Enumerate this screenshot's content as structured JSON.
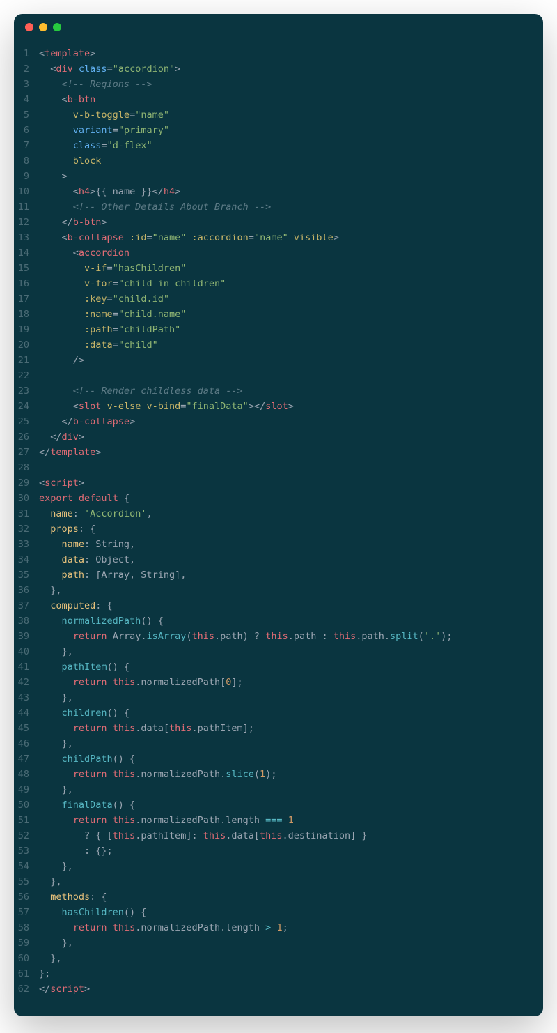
{
  "window": {
    "traffic_lights": [
      "close",
      "minimize",
      "zoom"
    ]
  },
  "code": {
    "lines": [
      {
        "n": 1,
        "t": [
          [
            "p",
            "<"
          ],
          [
            "t",
            "template"
          ],
          [
            "p",
            ">"
          ]
        ]
      },
      {
        "n": 2,
        "t": [
          [
            "p",
            "  <"
          ],
          [
            "t",
            "div"
          ],
          [
            "p",
            " "
          ],
          [
            "bl",
            "class"
          ],
          [
            "p",
            "="
          ],
          [
            "s",
            "\"accordion\""
          ],
          [
            "p",
            ">"
          ]
        ]
      },
      {
        "n": 3,
        "t": [
          [
            "c",
            "    <!-- Regions -->"
          ]
        ]
      },
      {
        "n": 4,
        "t": [
          [
            "p",
            "    <"
          ],
          [
            "t",
            "b-btn"
          ]
        ]
      },
      {
        "n": 5,
        "t": [
          [
            "p",
            "      "
          ],
          [
            "a",
            "v-b-toggle"
          ],
          [
            "p",
            "="
          ],
          [
            "s",
            "\"name\""
          ]
        ]
      },
      {
        "n": 6,
        "t": [
          [
            "p",
            "      "
          ],
          [
            "bl",
            "variant"
          ],
          [
            "p",
            "="
          ],
          [
            "s",
            "\"primary\""
          ]
        ]
      },
      {
        "n": 7,
        "t": [
          [
            "p",
            "      "
          ],
          [
            "bl",
            "class"
          ],
          [
            "p",
            "="
          ],
          [
            "s",
            "\"d-flex\""
          ]
        ]
      },
      {
        "n": 8,
        "t": [
          [
            "p",
            "      "
          ],
          [
            "a",
            "block"
          ]
        ]
      },
      {
        "n": 9,
        "t": [
          [
            "p",
            "    >"
          ]
        ]
      },
      {
        "n": 10,
        "t": [
          [
            "p",
            "      <"
          ],
          [
            "t",
            "h4"
          ],
          [
            "p",
            ">{{ name }}</"
          ],
          [
            "t",
            "h4"
          ],
          [
            "p",
            ">"
          ]
        ]
      },
      {
        "n": 11,
        "t": [
          [
            "c",
            "      <!-- Other Details About Branch -->"
          ]
        ]
      },
      {
        "n": 12,
        "t": [
          [
            "p",
            "    </"
          ],
          [
            "t",
            "b-btn"
          ],
          [
            "p",
            ">"
          ]
        ]
      },
      {
        "n": 13,
        "t": [
          [
            "p",
            "    <"
          ],
          [
            "t",
            "b-collapse"
          ],
          [
            "p",
            " "
          ],
          [
            "a",
            ":id"
          ],
          [
            "p",
            "="
          ],
          [
            "s",
            "\"name\""
          ],
          [
            "p",
            " "
          ],
          [
            "a",
            ":accordion"
          ],
          [
            "p",
            "="
          ],
          [
            "s",
            "\"name\""
          ],
          [
            "p",
            " "
          ],
          [
            "a",
            "visible"
          ],
          [
            "p",
            ">"
          ]
        ]
      },
      {
        "n": 14,
        "t": [
          [
            "p",
            "      <"
          ],
          [
            "t",
            "accordion"
          ]
        ]
      },
      {
        "n": 15,
        "t": [
          [
            "p",
            "        "
          ],
          [
            "a",
            "v-if"
          ],
          [
            "p",
            "="
          ],
          [
            "s",
            "\"hasChildren\""
          ]
        ]
      },
      {
        "n": 16,
        "t": [
          [
            "p",
            "        "
          ],
          [
            "a",
            "v-for"
          ],
          [
            "p",
            "="
          ],
          [
            "s",
            "\"child in children\""
          ]
        ]
      },
      {
        "n": 17,
        "t": [
          [
            "p",
            "        "
          ],
          [
            "a",
            ":key"
          ],
          [
            "p",
            "="
          ],
          [
            "s",
            "\"child.id\""
          ]
        ]
      },
      {
        "n": 18,
        "t": [
          [
            "p",
            "        "
          ],
          [
            "a",
            ":name"
          ],
          [
            "p",
            "="
          ],
          [
            "s",
            "\"child.name\""
          ]
        ]
      },
      {
        "n": 19,
        "t": [
          [
            "p",
            "        "
          ],
          [
            "a",
            ":path"
          ],
          [
            "p",
            "="
          ],
          [
            "s",
            "\"childPath\""
          ]
        ]
      },
      {
        "n": 20,
        "t": [
          [
            "p",
            "        "
          ],
          [
            "a",
            ":data"
          ],
          [
            "p",
            "="
          ],
          [
            "s",
            "\"child\""
          ]
        ]
      },
      {
        "n": 21,
        "t": [
          [
            "p",
            "      />"
          ]
        ]
      },
      {
        "n": 22,
        "t": [
          [
            "p",
            ""
          ]
        ]
      },
      {
        "n": 23,
        "t": [
          [
            "c",
            "      <!-- Render childless data -->"
          ]
        ]
      },
      {
        "n": 24,
        "t": [
          [
            "p",
            "      <"
          ],
          [
            "t",
            "slot"
          ],
          [
            "p",
            " "
          ],
          [
            "a",
            "v-else"
          ],
          [
            "p",
            " "
          ],
          [
            "a",
            "v-bind"
          ],
          [
            "p",
            "="
          ],
          [
            "s",
            "\"finalData\""
          ],
          [
            "p",
            "></"
          ],
          [
            "t",
            "slot"
          ],
          [
            "p",
            ">"
          ]
        ]
      },
      {
        "n": 25,
        "t": [
          [
            "p",
            "    </"
          ],
          [
            "t",
            "b-collapse"
          ],
          [
            "p",
            ">"
          ]
        ]
      },
      {
        "n": 26,
        "t": [
          [
            "p",
            "  </"
          ],
          [
            "t",
            "div"
          ],
          [
            "p",
            ">"
          ]
        ]
      },
      {
        "n": 27,
        "t": [
          [
            "p",
            "</"
          ],
          [
            "t",
            "template"
          ],
          [
            "p",
            ">"
          ]
        ]
      },
      {
        "n": 28,
        "t": [
          [
            "p",
            ""
          ]
        ]
      },
      {
        "n": 29,
        "t": [
          [
            "p",
            "<"
          ],
          [
            "t",
            "script"
          ],
          [
            "p",
            ">"
          ]
        ]
      },
      {
        "n": 30,
        "t": [
          [
            "k",
            "export"
          ],
          [
            "p",
            " "
          ],
          [
            "k",
            "default"
          ],
          [
            "p",
            " {"
          ]
        ]
      },
      {
        "n": 31,
        "t": [
          [
            "p",
            "  "
          ],
          [
            "pr",
            "name"
          ],
          [
            "p",
            ": "
          ],
          [
            "s",
            "'Accordion'"
          ],
          [
            "p",
            ","
          ]
        ]
      },
      {
        "n": 32,
        "t": [
          [
            "p",
            "  "
          ],
          [
            "pr",
            "props"
          ],
          [
            "p",
            ": {"
          ]
        ]
      },
      {
        "n": 33,
        "t": [
          [
            "p",
            "    "
          ],
          [
            "pr",
            "name"
          ],
          [
            "p",
            ": String,"
          ]
        ]
      },
      {
        "n": 34,
        "t": [
          [
            "p",
            "    "
          ],
          [
            "pr",
            "data"
          ],
          [
            "p",
            ": Object,"
          ]
        ]
      },
      {
        "n": 35,
        "t": [
          [
            "p",
            "    "
          ],
          [
            "pr",
            "path"
          ],
          [
            "p",
            ": [Array, String],"
          ]
        ]
      },
      {
        "n": 36,
        "t": [
          [
            "p",
            "  },"
          ]
        ]
      },
      {
        "n": 37,
        "t": [
          [
            "p",
            "  "
          ],
          [
            "pr",
            "computed"
          ],
          [
            "p",
            ": {"
          ]
        ]
      },
      {
        "n": 38,
        "t": [
          [
            "p",
            "    "
          ],
          [
            "f",
            "normalizedPath"
          ],
          [
            "p",
            "() {"
          ]
        ]
      },
      {
        "n": 39,
        "t": [
          [
            "p",
            "      "
          ],
          [
            "k",
            "return"
          ],
          [
            "p",
            " Array."
          ],
          [
            "f",
            "isArray"
          ],
          [
            "p",
            "("
          ],
          [
            "th",
            "this"
          ],
          [
            "p",
            ".path) ? "
          ],
          [
            "th",
            "this"
          ],
          [
            "p",
            ".path : "
          ],
          [
            "th",
            "this"
          ],
          [
            "p",
            ".path."
          ],
          [
            "f",
            "split"
          ],
          [
            "p",
            "("
          ],
          [
            "s",
            "'.'"
          ],
          [
            "p",
            ");"
          ]
        ]
      },
      {
        "n": 40,
        "t": [
          [
            "p",
            "    },"
          ]
        ]
      },
      {
        "n": 41,
        "t": [
          [
            "p",
            "    "
          ],
          [
            "f",
            "pathItem"
          ],
          [
            "p",
            "() {"
          ]
        ]
      },
      {
        "n": 42,
        "t": [
          [
            "p",
            "      "
          ],
          [
            "k",
            "return"
          ],
          [
            "p",
            " "
          ],
          [
            "th",
            "this"
          ],
          [
            "p",
            ".normalizedPath["
          ],
          [
            "n",
            "0"
          ],
          [
            "p",
            "];"
          ]
        ]
      },
      {
        "n": 43,
        "t": [
          [
            "p",
            "    },"
          ]
        ]
      },
      {
        "n": 44,
        "t": [
          [
            "p",
            "    "
          ],
          [
            "f",
            "children"
          ],
          [
            "p",
            "() {"
          ]
        ]
      },
      {
        "n": 45,
        "t": [
          [
            "p",
            "      "
          ],
          [
            "k",
            "return"
          ],
          [
            "p",
            " "
          ],
          [
            "th",
            "this"
          ],
          [
            "p",
            ".data["
          ],
          [
            "th",
            "this"
          ],
          [
            "p",
            ".pathItem];"
          ]
        ]
      },
      {
        "n": 46,
        "t": [
          [
            "p",
            "    },"
          ]
        ]
      },
      {
        "n": 47,
        "t": [
          [
            "p",
            "    "
          ],
          [
            "f",
            "childPath"
          ],
          [
            "p",
            "() {"
          ]
        ]
      },
      {
        "n": 48,
        "t": [
          [
            "p",
            "      "
          ],
          [
            "k",
            "return"
          ],
          [
            "p",
            " "
          ],
          [
            "th",
            "this"
          ],
          [
            "p",
            ".normalizedPath."
          ],
          [
            "f",
            "slice"
          ],
          [
            "p",
            "("
          ],
          [
            "n",
            "1"
          ],
          [
            "p",
            ");"
          ]
        ]
      },
      {
        "n": 49,
        "t": [
          [
            "p",
            "    },"
          ]
        ]
      },
      {
        "n": 50,
        "t": [
          [
            "p",
            "    "
          ],
          [
            "f",
            "finalData"
          ],
          [
            "p",
            "() {"
          ]
        ]
      },
      {
        "n": 51,
        "t": [
          [
            "p",
            "      "
          ],
          [
            "k",
            "return"
          ],
          [
            "p",
            " "
          ],
          [
            "th",
            "this"
          ],
          [
            "p",
            ".normalizedPath.length "
          ],
          [
            "o",
            "==="
          ],
          [
            "p",
            " "
          ],
          [
            "n",
            "1"
          ]
        ]
      },
      {
        "n": 52,
        "t": [
          [
            "p",
            "        ? { ["
          ],
          [
            "th",
            "this"
          ],
          [
            "p",
            ".pathItem]: "
          ],
          [
            "th",
            "this"
          ],
          [
            "p",
            ".data["
          ],
          [
            "th",
            "this"
          ],
          [
            "p",
            ".destination] }"
          ]
        ]
      },
      {
        "n": 53,
        "t": [
          [
            "p",
            "        : {};"
          ]
        ]
      },
      {
        "n": 54,
        "t": [
          [
            "p",
            "    },"
          ]
        ]
      },
      {
        "n": 55,
        "t": [
          [
            "p",
            "  },"
          ]
        ]
      },
      {
        "n": 56,
        "t": [
          [
            "p",
            "  "
          ],
          [
            "pr",
            "methods"
          ],
          [
            "p",
            ": {"
          ]
        ]
      },
      {
        "n": 57,
        "t": [
          [
            "p",
            "    "
          ],
          [
            "f",
            "hasChildren"
          ],
          [
            "p",
            "() {"
          ]
        ]
      },
      {
        "n": 58,
        "t": [
          [
            "p",
            "      "
          ],
          [
            "k",
            "return"
          ],
          [
            "p",
            " "
          ],
          [
            "th",
            "this"
          ],
          [
            "p",
            ".normalizedPath.length "
          ],
          [
            "o",
            ">"
          ],
          [
            "p",
            " "
          ],
          [
            "n",
            "1"
          ],
          [
            "p",
            ";"
          ]
        ]
      },
      {
        "n": 59,
        "t": [
          [
            "p",
            "    },"
          ]
        ]
      },
      {
        "n": 60,
        "t": [
          [
            "p",
            "  },"
          ]
        ]
      },
      {
        "n": 61,
        "t": [
          [
            "p",
            "};"
          ]
        ]
      },
      {
        "n": 62,
        "t": [
          [
            "p",
            "</"
          ],
          [
            "t",
            "script"
          ],
          [
            "p",
            ">"
          ]
        ]
      }
    ]
  }
}
